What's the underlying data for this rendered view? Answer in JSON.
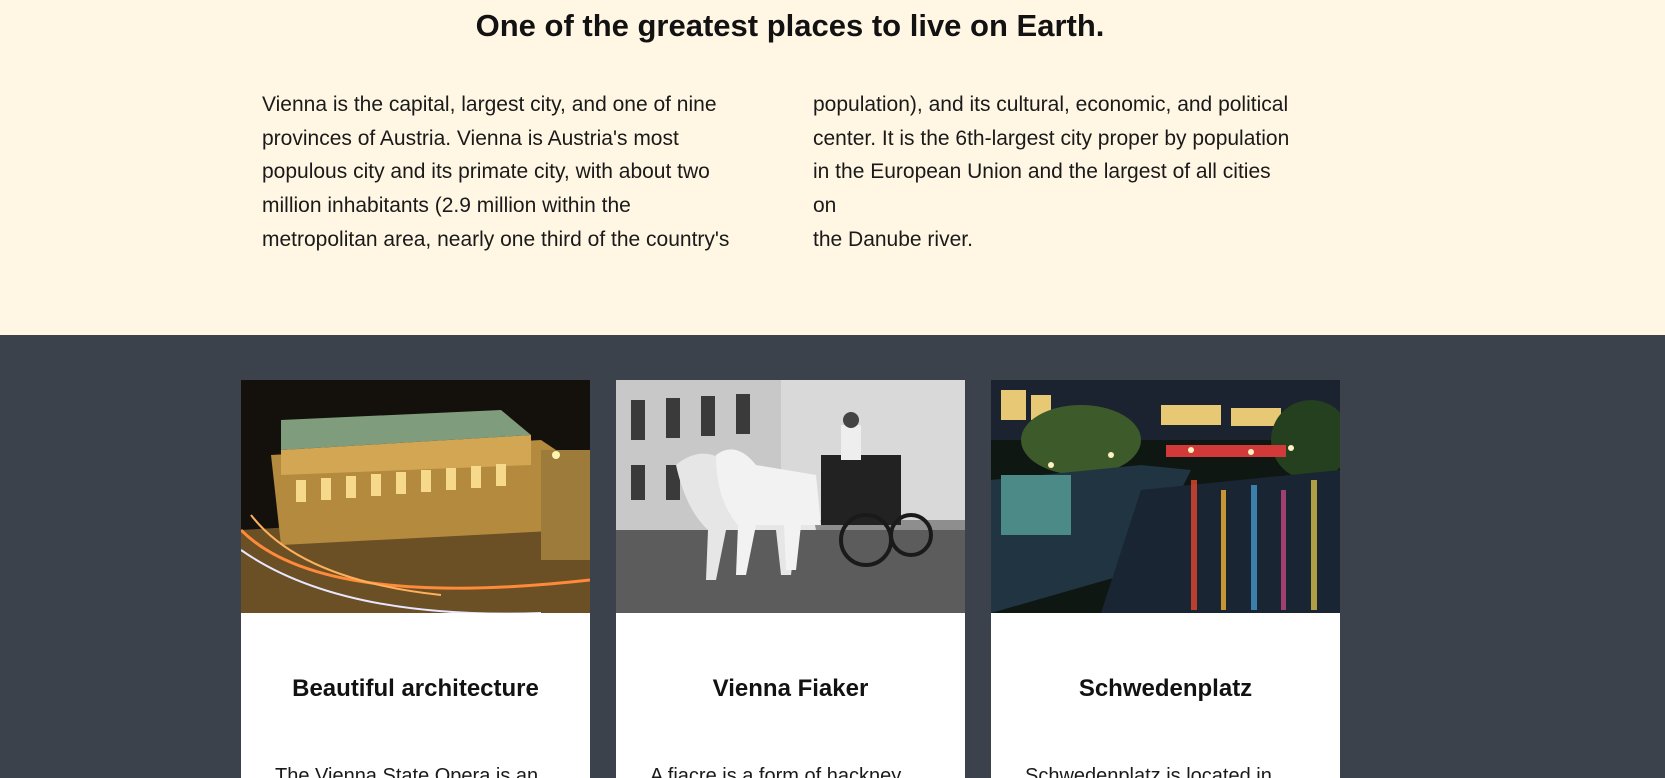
{
  "intro": {
    "heading": "One of the greatest places to live on Earth.",
    "lines_left": [
      "Vienna is the capital, largest city, and one of nine",
      "provinces of Austria. Vienna is Austria's most",
      "populous city and its primate city, with about two",
      "million inhabitants (2.9 million within the",
      "metropolitan area, nearly one third of the country's"
    ],
    "lines_right": [
      "population), and its cultural, economic, and political",
      "center. It is the 6th-largest city proper by population",
      "in the European Union and the largest of all cities on",
      "the Danube river."
    ]
  },
  "cards": [
    {
      "title": "Beautiful architecture",
      "text": "The Vienna State Opera is an"
    },
    {
      "title": "Vienna Fiaker",
      "text": "A fiacre is a form of hackney"
    },
    {
      "title": "Schwedenplatz",
      "text": "Schwedenplatz is located in"
    }
  ],
  "colors": {
    "intro_bg": "#fff6e4",
    "section_bg": "#3b424b",
    "card_bg": "#ffffff"
  }
}
